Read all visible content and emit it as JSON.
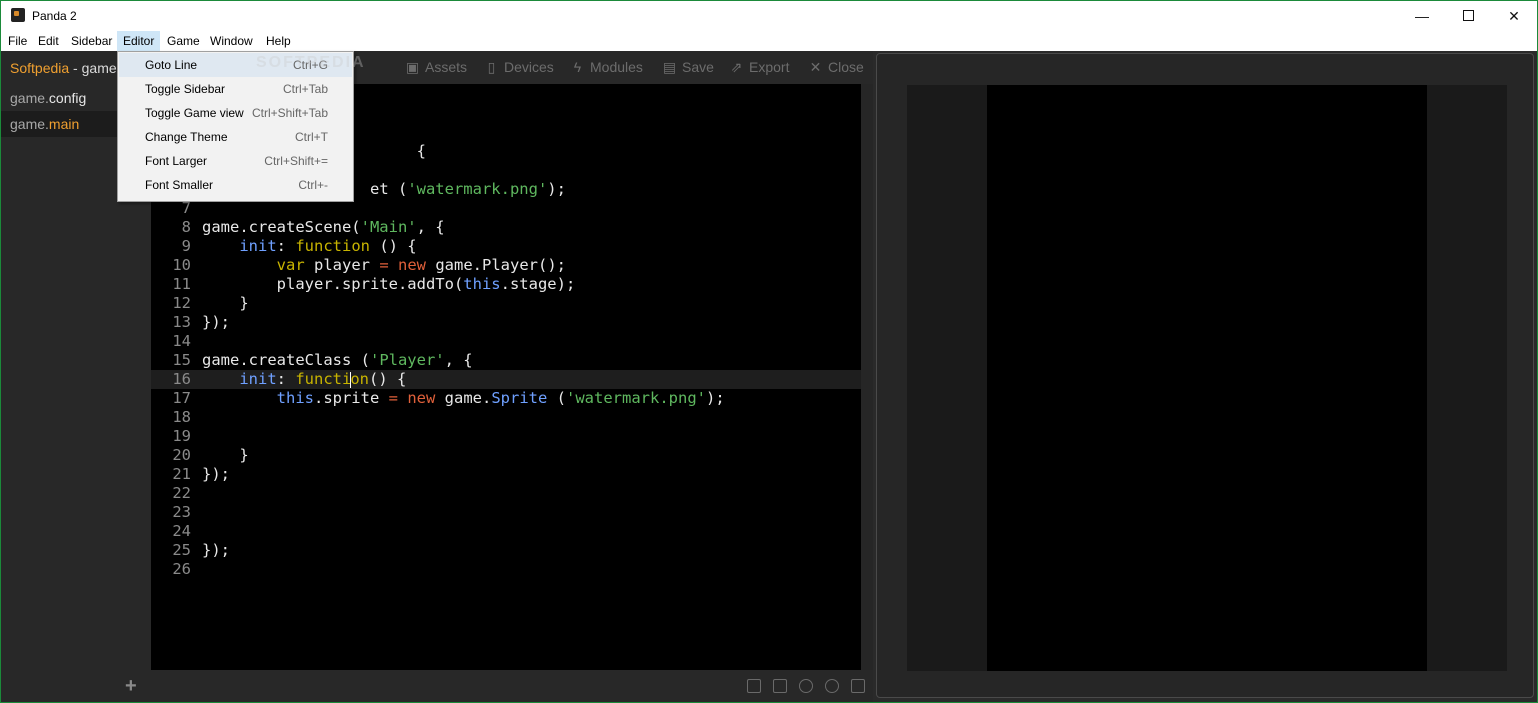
{
  "window": {
    "title": "Panda 2",
    "minimize": "—",
    "close": "✕"
  },
  "menubar": [
    "File",
    "Edit",
    "Sidebar",
    "Editor",
    "Game",
    "Window",
    "Help"
  ],
  "sidebar": {
    "project": "Softpedia",
    "separator": " - ",
    "current_file": "game.",
    "files": [
      {
        "base": "game.",
        "ext": "config",
        "selected": false
      },
      {
        "base": "game.",
        "ext": "main",
        "selected": true
      }
    ],
    "add": "+"
  },
  "toolbar": [
    "Assets",
    "Devices",
    "Modules",
    "Save",
    "Export",
    "Close"
  ],
  "editor_menu": [
    {
      "label": "Goto Line",
      "shortcut": "Ctrl+G"
    },
    {
      "label": "Toggle Sidebar",
      "shortcut": "Ctrl+Tab"
    },
    {
      "label": "Toggle Game view",
      "shortcut": "Ctrl+Shift+Tab"
    },
    {
      "label": "Change Theme",
      "shortcut": "Ctrl+T"
    },
    {
      "label": "Font Larger",
      "shortcut": "Ctrl+Shift+="
    },
    {
      "label": "Font Smaller",
      "shortcut": "Ctrl+-"
    }
  ],
  "watermark": "SOFTPEDIA",
  "code": {
    "numbers": [
      "7",
      "8",
      "9",
      "10",
      "11",
      "12",
      "13",
      "14",
      "15",
      "16",
      "17",
      "18",
      "19",
      "20",
      "21",
      "22",
      "23",
      "24",
      "25",
      "26"
    ],
    "fragment_line3": "{",
    "fragment_line5_a": "et (",
    "fragment_line5_b": "'watermark.png'",
    "fragment_line5_c": ");",
    "l8_a": "game.createScene(",
    "l8_b": "'Main'",
    "l8_c": ", {",
    "l9_a": "init",
    "l9_b": ": ",
    "l9_c": "function",
    "l9_d": " () {",
    "l10_a": "var",
    "l10_b": " player ",
    "l10_c": "=",
    "l10_d": " ",
    "l10_e": "new",
    "l10_f": " game.Player();",
    "l11_a": "player.sprite.addTo(",
    "l11_b": "this",
    "l11_c": ".stage);",
    "l12": "}",
    "l13": "});",
    "l15_a": "game.createClass (",
    "l15_b": "'Player'",
    "l15_c": ", {",
    "l16_a": "init",
    "l16_b": ": ",
    "l16_c": "functi",
    "l16_d": "on",
    "l16_e": "() {",
    "l17_a": "this",
    "l17_b": ".sprite ",
    "l17_c": "=",
    "l17_d": " ",
    "l17_e": "new",
    "l17_f": " game.",
    "l17_g": "Sprite",
    "l17_h": " (",
    "l17_i": "'watermark.png'",
    "l17_j": ");",
    "l20": "}",
    "l21": "});",
    "l25": "});"
  }
}
